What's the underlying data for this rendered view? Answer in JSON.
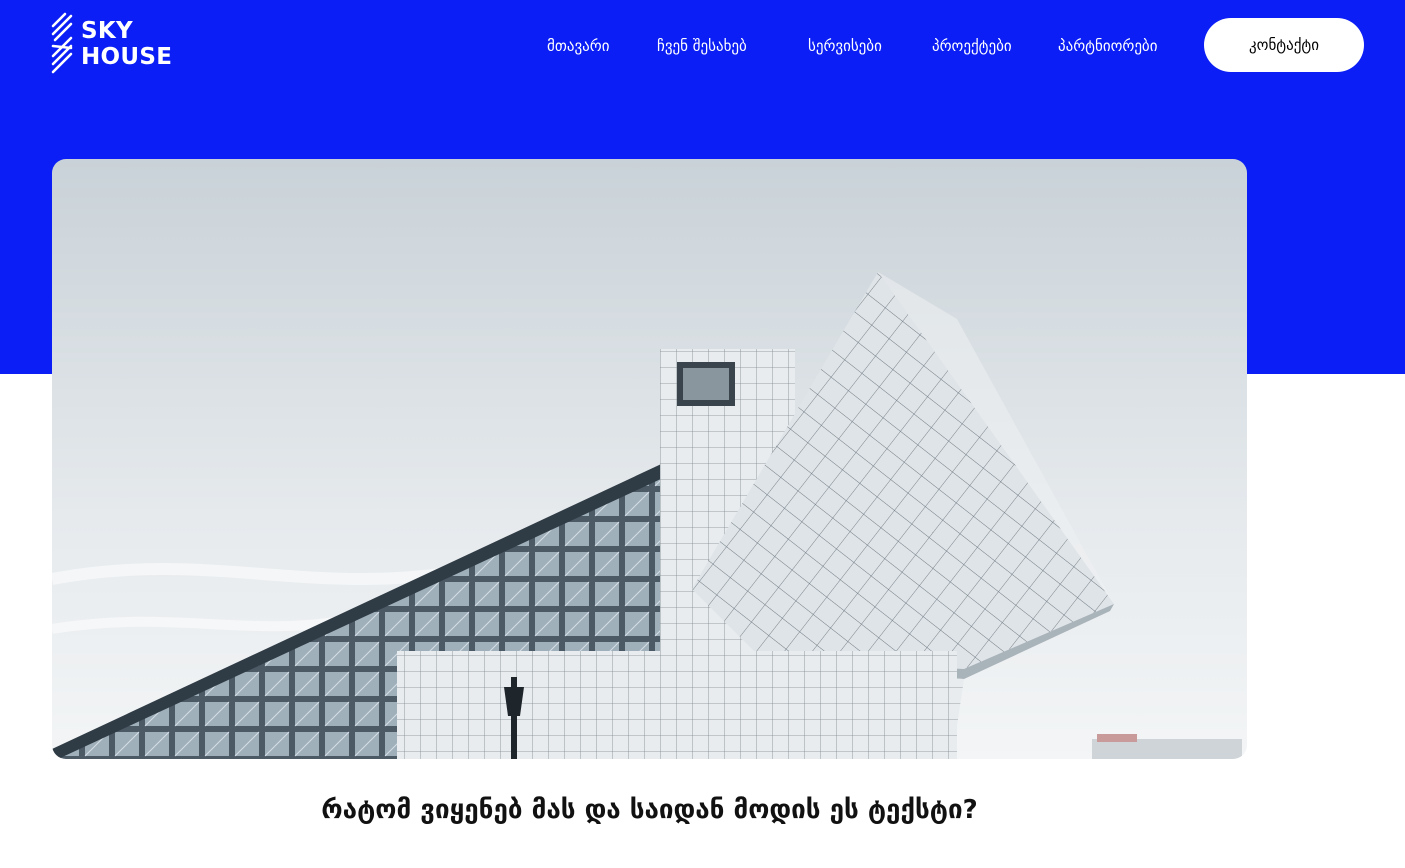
{
  "brand": {
    "name_line1": "SKY",
    "name_line2": "HOUSE",
    "logo_icon": "diagonal-stripes-logo-icon"
  },
  "nav": {
    "items": [
      {
        "label": "მთავარი"
      },
      {
        "label": "ჩვენ შესახებ"
      },
      {
        "label": "სერვისები"
      },
      {
        "label": "პროექტები"
      },
      {
        "label": "პარტნიორები"
      }
    ],
    "contact_label": "კონტაქტი"
  },
  "hero": {
    "image_subject": "modern-glass-building-photo"
  },
  "article": {
    "title": "რატომ ვიყენებ მას და საიდან მოდის ეს ტექსტი?"
  },
  "colors": {
    "brand_blue": "#0a1ef5",
    "white": "#ffffff",
    "text_dark": "#111111"
  }
}
